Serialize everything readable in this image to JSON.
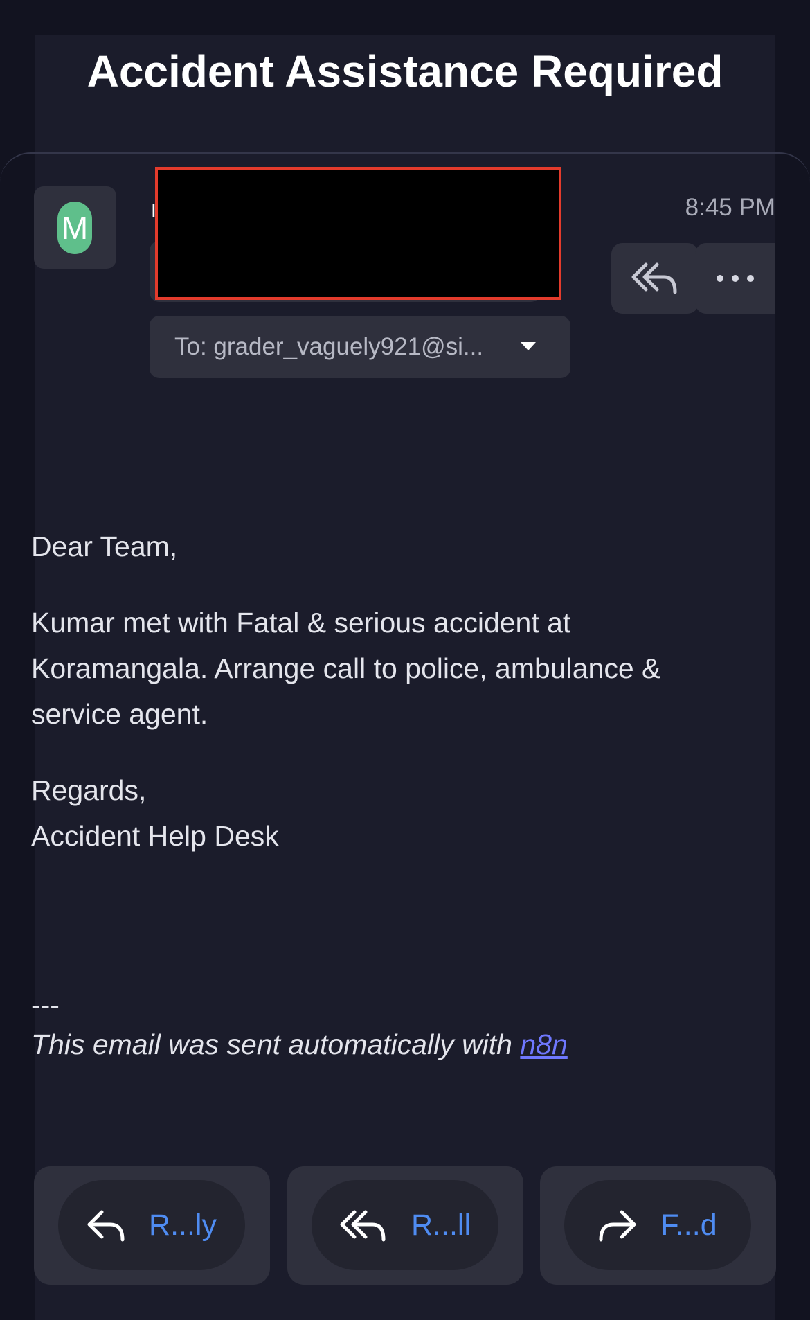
{
  "email": {
    "subject": "Accident Assistance Required",
    "sender_initial": "M",
    "sender_name_partial": "I",
    "time": "8:45 PM",
    "to": "To: grader_vaguely921@si..."
  },
  "body": {
    "greeting": "Dear Team,",
    "paragraph_lines": [
      "Kumar met with Fatal & serious accident at",
      "Koramangala. Arrange call to police, ambulance &",
      "service agent."
    ],
    "signoff": "Regards,",
    "signature": "Accident Help Desk",
    "separator": "---",
    "footer_text": "This email was sent automatically with ",
    "footer_link": "n8n"
  },
  "actions": {
    "reply": "R...ly",
    "reply_all": "R...ll",
    "forward": "F...d"
  },
  "icons": {
    "reply_all_header": "reply-all-icon",
    "more": "more-icon",
    "dropdown": "chevron-down-icon",
    "reply": "reply-icon",
    "forward": "forward-icon"
  },
  "colors": {
    "background": "#121320",
    "panel": "#1b1c2b",
    "chip": "#2f303d",
    "accent": "#4f8cf2",
    "link": "#6f78ff",
    "avatar": "#5fbf8b",
    "redaction_border": "#e33b2c"
  }
}
